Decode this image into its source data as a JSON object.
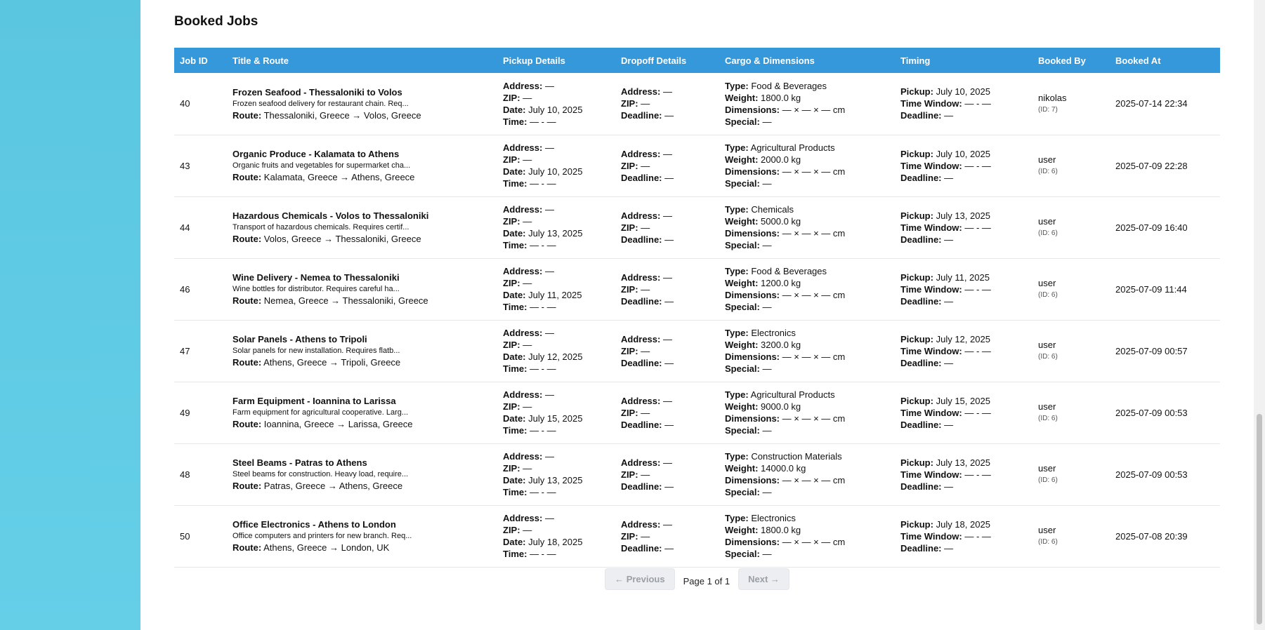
{
  "section": {
    "title": "Booked Jobs"
  },
  "table": {
    "headers": [
      "Job ID",
      "Title & Route",
      "Pickup Details",
      "Dropoff Details",
      "Cargo & Dimensions",
      "Timing",
      "Booked By",
      "Booked At"
    ],
    "labels": {
      "route": "Route:",
      "address": "Address:",
      "zip": "ZIP:",
      "date": "Date:",
      "time": "Time:",
      "deadline": "Deadline:",
      "type": "Type:",
      "weight": "Weight:",
      "dimensions": "Dimensions:",
      "special": "Special:",
      "pickup": "Pickup:",
      "time_window": "Time Window:"
    },
    "rows": [
      {
        "id": "40",
        "title": "Frozen Seafood - Thessaloniki to Volos",
        "desc": "Frozen seafood delivery for restaurant chain. Req...",
        "route": "Thessaloniki, Greece → Volos, Greece",
        "p_address": "—",
        "p_zip": "—",
        "p_date": "July 10, 2025",
        "p_time": "— - —",
        "d_address": "—",
        "d_zip": "—",
        "d_deadline": "—",
        "type": "Food & Beverages",
        "weight": "1800.0 kg",
        "dims": "— × — × — cm",
        "special": "—",
        "t_pickup": "July 10, 2025",
        "t_window": "— - —",
        "t_deadline": "—",
        "booked_by": "nikolas",
        "booked_by_id": "(ID: 7)",
        "booked_at": "2025-07-14 22:34"
      },
      {
        "id": "43",
        "title": "Organic Produce - Kalamata to Athens",
        "desc": "Organic fruits and vegetables for supermarket cha...",
        "route": "Kalamata, Greece → Athens, Greece",
        "p_address": "—",
        "p_zip": "—",
        "p_date": "July 10, 2025",
        "p_time": "— - —",
        "d_address": "—",
        "d_zip": "—",
        "d_deadline": "—",
        "type": "Agricultural Products",
        "weight": "2000.0 kg",
        "dims": "— × — × — cm",
        "special": "—",
        "t_pickup": "July 10, 2025",
        "t_window": "— - —",
        "t_deadline": "—",
        "booked_by": "user",
        "booked_by_id": "(ID: 6)",
        "booked_at": "2025-07-09 22:28"
      },
      {
        "id": "44",
        "title": "Hazardous Chemicals - Volos to Thessaloniki",
        "desc": "Transport of hazardous chemicals. Requires certif...",
        "route": "Volos, Greece → Thessaloniki, Greece",
        "p_address": "—",
        "p_zip": "—",
        "p_date": "July 13, 2025",
        "p_time": "— - —",
        "d_address": "—",
        "d_zip": "—",
        "d_deadline": "—",
        "type": "Chemicals",
        "weight": "5000.0 kg",
        "dims": "— × — × — cm",
        "special": "—",
        "t_pickup": "July 13, 2025",
        "t_window": "— - —",
        "t_deadline": "—",
        "booked_by": "user",
        "booked_by_id": "(ID: 6)",
        "booked_at": "2025-07-09 16:40"
      },
      {
        "id": "46",
        "title": "Wine Delivery - Nemea to Thessaloniki",
        "desc": "Wine bottles for distributor. Requires careful ha...",
        "route": "Nemea, Greece → Thessaloniki, Greece",
        "p_address": "—",
        "p_zip": "—",
        "p_date": "July 11, 2025",
        "p_time": "— - —",
        "d_address": "—",
        "d_zip": "—",
        "d_deadline": "—",
        "type": "Food & Beverages",
        "weight": "1200.0 kg",
        "dims": "— × — × — cm",
        "special": "—",
        "t_pickup": "July 11, 2025",
        "t_window": "— - —",
        "t_deadline": "—",
        "booked_by": "user",
        "booked_by_id": "(ID: 6)",
        "booked_at": "2025-07-09 11:44"
      },
      {
        "id": "47",
        "title": "Solar Panels - Athens to Tripoli",
        "desc": "Solar panels for new installation. Requires flatb...",
        "route": "Athens, Greece → Tripoli, Greece",
        "p_address": "—",
        "p_zip": "—",
        "p_date": "July 12, 2025",
        "p_time": "— - —",
        "d_address": "—",
        "d_zip": "—",
        "d_deadline": "—",
        "type": "Electronics",
        "weight": "3200.0 kg",
        "dims": "— × — × — cm",
        "special": "—",
        "t_pickup": "July 12, 2025",
        "t_window": "— - —",
        "t_deadline": "—",
        "booked_by": "user",
        "booked_by_id": "(ID: 6)",
        "booked_at": "2025-07-09 00:57"
      },
      {
        "id": "49",
        "title": "Farm Equipment - Ioannina to Larissa",
        "desc": "Farm equipment for agricultural cooperative. Larg...",
        "route": "Ioannina, Greece → Larissa, Greece",
        "p_address": "—",
        "p_zip": "—",
        "p_date": "July 15, 2025",
        "p_time": "— - —",
        "d_address": "—",
        "d_zip": "—",
        "d_deadline": "—",
        "type": "Agricultural Products",
        "weight": "9000.0 kg",
        "dims": "— × — × — cm",
        "special": "—",
        "t_pickup": "July 15, 2025",
        "t_window": "— - —",
        "t_deadline": "—",
        "booked_by": "user",
        "booked_by_id": "(ID: 6)",
        "booked_at": "2025-07-09 00:53"
      },
      {
        "id": "48",
        "title": "Steel Beams - Patras to Athens",
        "desc": "Steel beams for construction. Heavy load, require...",
        "route": "Patras, Greece → Athens, Greece",
        "p_address": "—",
        "p_zip": "—",
        "p_date": "July 13, 2025",
        "p_time": "— - —",
        "d_address": "—",
        "d_zip": "—",
        "d_deadline": "—",
        "type": "Construction Materials",
        "weight": "14000.0 kg",
        "dims": "— × — × — cm",
        "special": "—",
        "t_pickup": "July 13, 2025",
        "t_window": "— - —",
        "t_deadline": "—",
        "booked_by": "user",
        "booked_by_id": "(ID: 6)",
        "booked_at": "2025-07-09 00:53"
      },
      {
        "id": "50",
        "title": "Office Electronics - Athens to London",
        "desc": "Office computers and printers for new branch. Req...",
        "route": "Athens, Greece → London, UK",
        "p_address": "—",
        "p_zip": "—",
        "p_date": "July 18, 2025",
        "p_time": "— - —",
        "d_address": "—",
        "d_zip": "—",
        "d_deadline": "—",
        "type": "Electronics",
        "weight": "1800.0 kg",
        "dims": "— × — × — cm",
        "special": "—",
        "t_pickup": "July 18, 2025",
        "t_window": "— - —",
        "t_deadline": "—",
        "booked_by": "user",
        "booked_by_id": "(ID: 6)",
        "booked_at": "2025-07-08 20:39"
      }
    ]
  },
  "pagination": {
    "prev_label": "← Previous",
    "info": "Page 1 of 1",
    "next_label": "Next →"
  }
}
